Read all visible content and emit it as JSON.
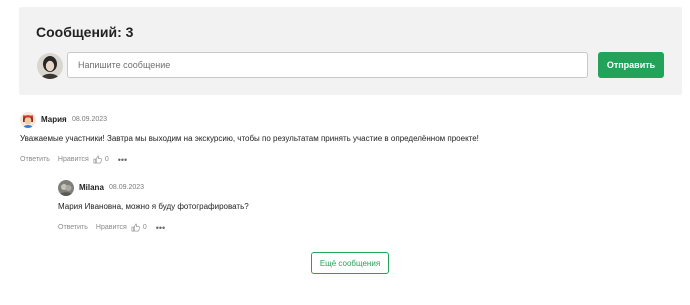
{
  "composer": {
    "title": "Сообщений: 3",
    "input_placeholder": "Напишите сообщение",
    "send_label": "Отправить"
  },
  "comments": [
    {
      "author": "Мария",
      "date": "08.09.2023",
      "text": "Уважаемые участники! Завтра мы выходим на экскурсию, чтобы по результатам принять участие в определённом проекте!",
      "reply_label": "Ответить",
      "like_label": "Нравится",
      "like_count": "0",
      "more_label": "•••"
    },
    {
      "author": "Milana",
      "date": "08.09.2023",
      "text": "Мария Ивановна, можно я буду фотографировать?",
      "reply_label": "Ответить",
      "like_label": "Нравится",
      "like_count": "0",
      "more_label": "•••"
    }
  ],
  "load_more_label": "Ещё сообщения",
  "colors": {
    "accent": "#23a35a",
    "panel": "#f2f2f2"
  },
  "icons": [
    "user-avatar-icon",
    "thumbs-up-icon",
    "more-dots-icon"
  ]
}
